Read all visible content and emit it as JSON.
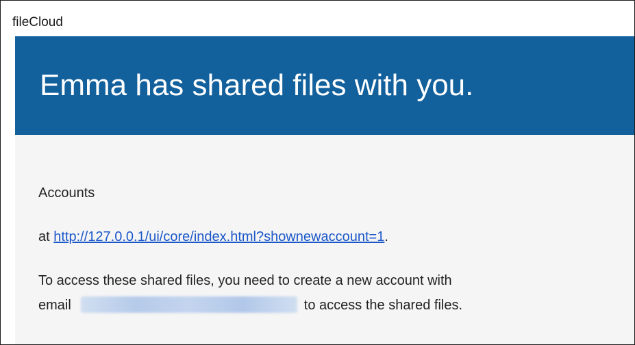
{
  "header": {
    "app_name": "fileCloud"
  },
  "banner": {
    "title": "Emma has shared files with you."
  },
  "content": {
    "section_label": "Accounts",
    "at_prefix": "at ",
    "link_url": "http://127.0.0.1/ui/core/index.html?shownewaccount=1",
    "at_suffix": ".",
    "access_sentence": "To access these shared files, you need to create a new account with",
    "email_prefix": "email",
    "email_suffix": "to access the shared files."
  },
  "colors": {
    "banner_bg": "#12609c",
    "body_bg": "#f5f5f5",
    "link": "#1a57c9"
  }
}
